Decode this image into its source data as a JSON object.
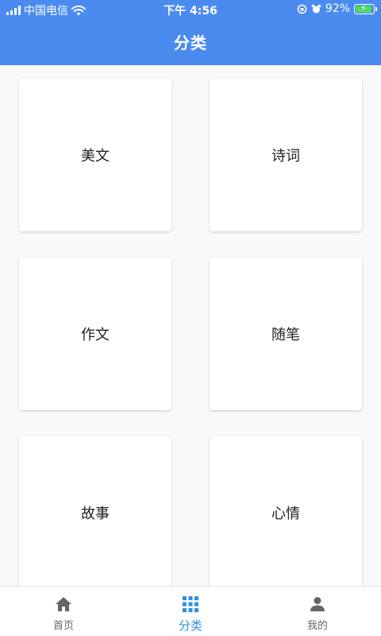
{
  "status_bar": {
    "carrier": "中国电信",
    "time": "下午 4:56",
    "battery": "92%"
  },
  "header": {
    "title": "分类"
  },
  "categories": [
    {
      "label": "美文"
    },
    {
      "label": "诗词"
    },
    {
      "label": "作文"
    },
    {
      "label": "随笔"
    },
    {
      "label": "故事"
    },
    {
      "label": "心情"
    }
  ],
  "tabbar": {
    "items": [
      {
        "label": "首页",
        "icon": "home-icon"
      },
      {
        "label": "分类",
        "icon": "grid-icon",
        "active": true
      },
      {
        "label": "我的",
        "icon": "person-icon"
      }
    ]
  },
  "colors": {
    "header": "#4b8bf0",
    "active_tab": "#2f8fe0",
    "inactive_tab": "#666666",
    "battery_fill": "#4cd964"
  }
}
